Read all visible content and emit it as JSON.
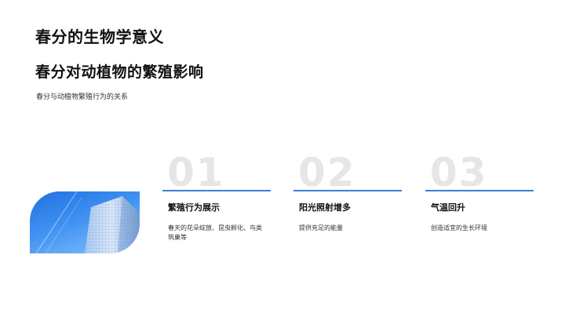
{
  "slide": {
    "title": "春分的生物学意义",
    "subtitle": "春分对动植物的繁殖影响",
    "description": "春分与动植物繁殖行为的关系"
  },
  "cards": [
    {
      "number": "01",
      "title": "繁殖行为展示",
      "text": "春天的花朵绽放、昆虫孵化、鸟类筑巢等"
    },
    {
      "number": "02",
      "title": "阳光照射增多",
      "text": "提供充足的能量"
    },
    {
      "number": "03",
      "title": "气温回升",
      "text": "创造适宜的生长环境"
    }
  ],
  "image": {
    "icon": "skyscraper-photo"
  },
  "colors": {
    "accent": "#3f7de0",
    "number": "#e6e6e6",
    "text": "#111111"
  }
}
